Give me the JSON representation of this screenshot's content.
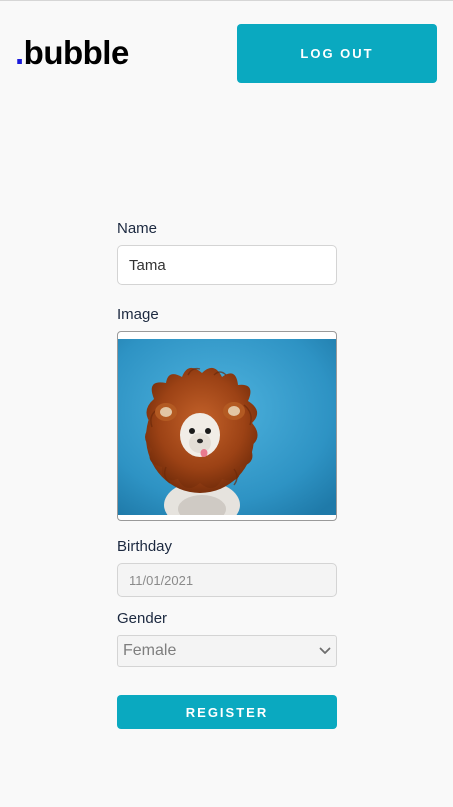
{
  "header": {
    "logo_dot": ".",
    "logo_text": "bubble",
    "logout_label": "LOG OUT"
  },
  "form": {
    "name_label": "Name",
    "name_value": "Tama",
    "image_label": "Image",
    "birthday_label": "Birthday",
    "birthday_value": "11/01/2021",
    "gender_label": "Gender",
    "gender_value": "Female",
    "register_label": "REGISTER"
  },
  "icons": {
    "select_arrow": "chevron-down-icon"
  },
  "colors": {
    "accent": "#0aa9c0",
    "logo_dot": "#1a1adb",
    "label_text": "#1c2940"
  }
}
